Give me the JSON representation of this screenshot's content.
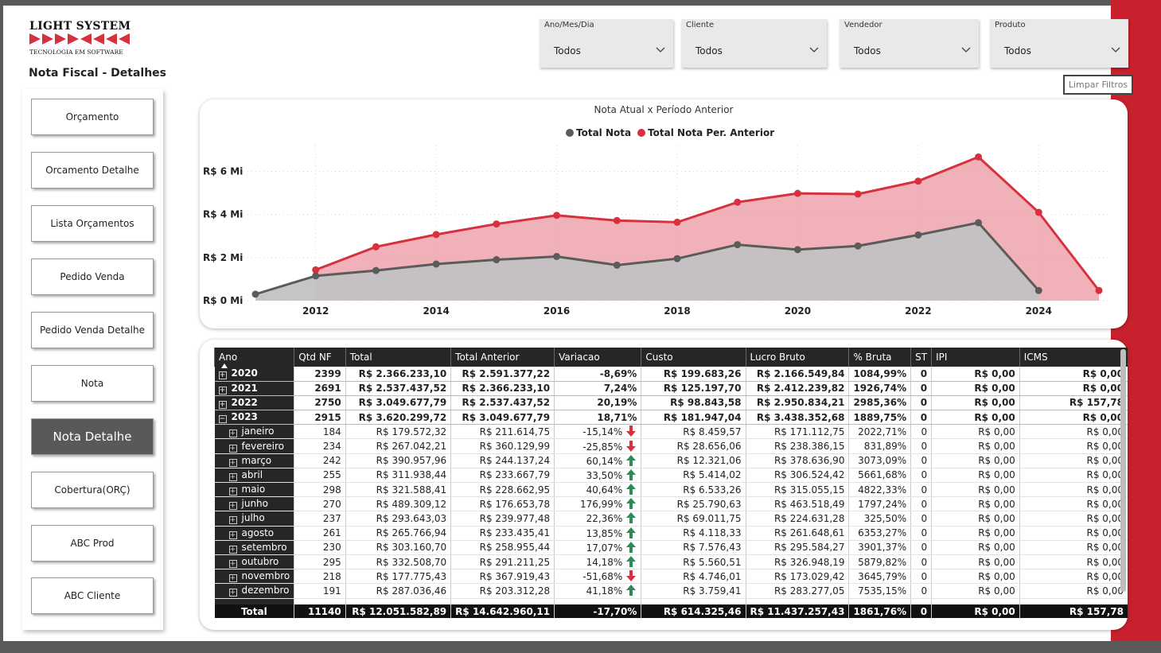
{
  "app": {
    "logo_title": "LIGHT SYSTEM",
    "logo_subtitle": "TECNOLOGIA EM SOFTWARE",
    "page_title": "Nota Fiscal - Detalhes"
  },
  "nav": {
    "items": [
      {
        "label": "Orçamento"
      },
      {
        "label": "Orcamento Detalhe"
      },
      {
        "label": "Lista Orçamentos"
      },
      {
        "label": "Pedido Venda"
      },
      {
        "label": "Pedido Venda Detalhe"
      },
      {
        "label": "Nota"
      },
      {
        "label": "Nota Detalhe",
        "active": true
      },
      {
        "label": "Cobertura(ORÇ)"
      },
      {
        "label": "ABC Prod"
      },
      {
        "label": "ABC Cliente"
      }
    ]
  },
  "filters": [
    {
      "label": "Ano/Mes/Dia",
      "value": "Todos"
    },
    {
      "label": "Cliente",
      "value": "Todos"
    },
    {
      "label": "Vendedor",
      "value": "Todos"
    },
    {
      "label": "Produto",
      "value": "Todos"
    }
  ],
  "clear_filters_label": "Limpar Filtros",
  "colors": {
    "accent_red": "#d7313f",
    "accent_red_fill": "#eea3ab",
    "series_gray": "#5b5b5b",
    "series_gray_fill": "#c2c2c2",
    "header_dark": "#262626",
    "frame_gray": "#5a5a5a",
    "frame_red": "#c8202d",
    "arrow_up": "#2e8b57",
    "arrow_down": "#d7313f"
  },
  "chart_data": {
    "type": "area",
    "title": "Nota Atual x Período Anterior",
    "x": [
      2011,
      2012,
      2013,
      2014,
      2015,
      2016,
      2017,
      2018,
      2019,
      2020,
      2021,
      2022,
      2023,
      2024,
      2025
    ],
    "x_tick_labels": [
      "2012",
      "2014",
      "2016",
      "2018",
      "2020",
      "2022",
      "2024"
    ],
    "y_tick_labels": [
      "R$ 0 Mi",
      "R$ 2 Mi",
      "R$ 4 Mi",
      "R$ 6 Mi"
    ],
    "ylim": [
      0,
      7.2
    ],
    "y_unit": "Mi",
    "grid": true,
    "legend_position": "top-center",
    "series": [
      {
        "name": "Total Nota",
        "color": "#5b5b5b",
        "values": [
          0.3,
          1.15,
          1.4,
          1.7,
          1.9,
          2.05,
          1.65,
          1.95,
          2.6,
          2.37,
          2.54,
          3.05,
          3.62,
          0.47,
          null
        ]
      },
      {
        "name": "Total Nota Per. Anterior",
        "color": "#d7313f",
        "values": [
          null,
          1.43,
          2.5,
          3.07,
          3.56,
          3.96,
          3.72,
          3.64,
          4.57,
          4.98,
          4.95,
          5.55,
          6.67,
          4.1,
          0.47
        ]
      }
    ]
  },
  "table": {
    "columns": [
      "Ano",
      "Qtd NF",
      "Total",
      "Total Anterior",
      "Variacao",
      "Custo",
      "Lucro Bruto",
      "% Bruta",
      "ST",
      "IPI",
      "ICMS"
    ],
    "rows": [
      {
        "type": "year",
        "expand": "+",
        "cells": [
          "2020",
          "2399",
          "R$ 2.366.233,10",
          "R$ 2.591.377,22",
          "-8,69%",
          "R$ 199.683,26",
          "R$ 2.166.549,84",
          "1084,99%",
          "0",
          "R$ 0,00",
          "R$ 0,00"
        ]
      },
      {
        "type": "year",
        "expand": "+",
        "cells": [
          "2021",
          "2691",
          "R$ 2.537.437,52",
          "R$ 2.366.233,10",
          "7,24%",
          "R$ 125.197,70",
          "R$ 2.412.239,82",
          "1926,74%",
          "0",
          "R$ 0,00",
          "R$ 0,00"
        ]
      },
      {
        "type": "year",
        "expand": "+",
        "cells": [
          "2022",
          "2750",
          "R$ 3.049.677,79",
          "R$ 2.537.437,52",
          "20,19%",
          "R$ 98.843,58",
          "R$ 2.950.834,21",
          "2985,36%",
          "0",
          "R$ 0,00",
          "R$ 157,78"
        ]
      },
      {
        "type": "year",
        "expand": "−",
        "cells": [
          "2023",
          "2915",
          "R$ 3.620.299,72",
          "R$ 3.049.677,79",
          "18,71%",
          "R$ 181.947,04",
          "R$ 3.438.352,68",
          "1889,75%",
          "0",
          "R$ 0,00",
          "R$ 0,00"
        ]
      },
      {
        "type": "month",
        "expand": "+",
        "trend": "down",
        "cells": [
          "janeiro",
          "184",
          "R$ 179.572,32",
          "R$ 211.614,75",
          "-15,14%",
          "R$ 8.459,57",
          "R$ 171.112,75",
          "2022,71%",
          "0",
          "R$ 0,00",
          "R$ 0,00"
        ]
      },
      {
        "type": "month",
        "expand": "+",
        "trend": "down",
        "cells": [
          "fevereiro",
          "234",
          "R$ 267.042,21",
          "R$ 360.129,99",
          "-25,85%",
          "R$ 28.656,06",
          "R$ 238.386,15",
          "831,89%",
          "0",
          "R$ 0,00",
          "R$ 0,00"
        ]
      },
      {
        "type": "month",
        "expand": "+",
        "trend": "up",
        "cells": [
          "março",
          "242",
          "R$ 390.957,96",
          "R$ 244.137,24",
          "60,14%",
          "R$ 12.321,06",
          "R$ 378.636,90",
          "3073,09%",
          "0",
          "R$ 0,00",
          "R$ 0,00"
        ]
      },
      {
        "type": "month",
        "expand": "+",
        "trend": "up",
        "cells": [
          "abril",
          "255",
          "R$ 311.938,44",
          "R$ 233.667,79",
          "33,50%",
          "R$ 5.414,02",
          "R$ 306.524,42",
          "5661,68%",
          "0",
          "R$ 0,00",
          "R$ 0,00"
        ]
      },
      {
        "type": "month",
        "expand": "+",
        "trend": "up",
        "cells": [
          "maio",
          "298",
          "R$ 321.588,41",
          "R$ 228.662,95",
          "40,64%",
          "R$ 6.533,26",
          "R$ 315.055,15",
          "4822,33%",
          "0",
          "R$ 0,00",
          "R$ 0,00"
        ]
      },
      {
        "type": "month",
        "expand": "+",
        "trend": "up",
        "cells": [
          "junho",
          "270",
          "R$ 489.309,12",
          "R$ 176.653,78",
          "176,99%",
          "R$ 25.790,63",
          "R$ 463.518,49",
          "1797,24%",
          "0",
          "R$ 0,00",
          "R$ 0,00"
        ]
      },
      {
        "type": "month",
        "expand": "+",
        "trend": "up",
        "cells": [
          "julho",
          "237",
          "R$ 293.643,03",
          "R$ 239.977,48",
          "22,36%",
          "R$ 69.011,75",
          "R$ 224.631,28",
          "325,50%",
          "0",
          "R$ 0,00",
          "R$ 0,00"
        ]
      },
      {
        "type": "month",
        "expand": "+",
        "trend": "up",
        "cells": [
          "agosto",
          "261",
          "R$ 265.766,94",
          "R$ 233.435,41",
          "13,85%",
          "R$ 4.118,33",
          "R$ 261.648,61",
          "6353,27%",
          "0",
          "R$ 0,00",
          "R$ 0,00"
        ]
      },
      {
        "type": "month",
        "expand": "+",
        "trend": "up",
        "cells": [
          "setembro",
          "230",
          "R$ 303.160,70",
          "R$ 258.955,44",
          "17,07%",
          "R$ 7.576,43",
          "R$ 295.584,27",
          "3901,37%",
          "0",
          "R$ 0,00",
          "R$ 0,00"
        ]
      },
      {
        "type": "month",
        "expand": "+",
        "trend": "up",
        "cells": [
          "outubro",
          "295",
          "R$ 332.508,70",
          "R$ 291.211,25",
          "14,18%",
          "R$ 5.560,51",
          "R$ 326.948,19",
          "5879,82%",
          "0",
          "R$ 0,00",
          "R$ 0,00"
        ]
      },
      {
        "type": "month",
        "expand": "+",
        "trend": "down",
        "cells": [
          "novembro",
          "218",
          "R$ 177.775,43",
          "R$ 367.919,43",
          "-51,68%",
          "R$ 4.746,01",
          "R$ 173.029,42",
          "3645,79%",
          "0",
          "R$ 0,00",
          "R$ 0,00"
        ]
      },
      {
        "type": "month",
        "expand": "+",
        "trend": "up",
        "cells": [
          "dezembro",
          "191",
          "R$ 287.036,46",
          "R$ 203.312,28",
          "41,18%",
          "R$ 3.759,41",
          "R$ 283.277,05",
          "7535,15%",
          "0",
          "R$ 0,00",
          "R$ 0,00"
        ]
      }
    ],
    "total_row": [
      "Total",
      "11140",
      "R$ 12.051.582,89",
      "R$ 14.642.960,11",
      "-17,70%",
      "R$ 614.325,46",
      "R$ 11.437.257,43",
      "1861,76%",
      "0",
      "R$ 0,00",
      "R$ 157,78"
    ]
  }
}
